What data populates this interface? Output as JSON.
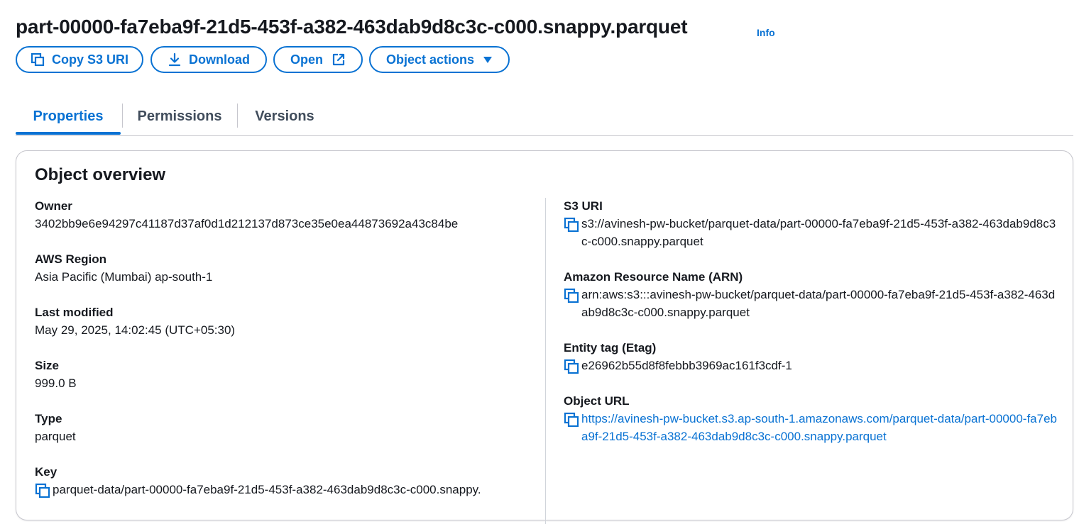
{
  "header": {
    "title": "part-00000-fa7eba9f-21d5-453f-a382-463dab9d8c3c-c000.snappy.parquet",
    "info_label": "Info"
  },
  "actions": {
    "copy_uri": "Copy S3 URI",
    "download": "Download",
    "open": "Open",
    "object_actions": "Object actions"
  },
  "tabs": [
    {
      "label": "Properties",
      "active": true
    },
    {
      "label": "Permissions",
      "active": false
    },
    {
      "label": "Versions",
      "active": false
    }
  ],
  "overview": {
    "title": "Object overview",
    "left": {
      "owner": {
        "label": "Owner",
        "value": "3402bb9e6e94297c41187d37af0d1d212137d873ce35e0ea44873692a43c84be"
      },
      "region": {
        "label": "AWS Region",
        "value": "Asia Pacific (Mumbai) ap-south-1"
      },
      "modified": {
        "label": "Last modified",
        "value": "May 29, 2025, 14:02:45 (UTC+05:30)"
      },
      "size": {
        "label": "Size",
        "value": "999.0 B"
      },
      "type": {
        "label": "Type",
        "value": "parquet"
      },
      "key": {
        "label": "Key",
        "value": "parquet-data/part-00000-fa7eba9f-21d5-453f-a382-463dab9d8c3c-c000.snappy."
      }
    },
    "right": {
      "s3uri": {
        "label": "S3 URI",
        "value": "s3://avinesh-pw-bucket/parquet-data/part-00000-fa7eba9f-21d5-453f-a382-463dab9d8c3c-c000.snappy.parquet"
      },
      "arn": {
        "label": "Amazon Resource Name (ARN)",
        "value": "arn:aws:s3:::avinesh-pw-bucket/parquet-data/part-00000-fa7eba9f-21d5-453f-a382-463dab9d8c3c-c000.snappy.parquet"
      },
      "etag": {
        "label": "Entity tag (Etag)",
        "value": "e26962b55d8f8febbb3969ac161f3cdf-1"
      },
      "url": {
        "label": "Object URL",
        "value": "https://avinesh-pw-bucket.s3.ap-south-1.amazonaws.com/parquet-data/part-00000-fa7eba9f-21d5-453f-a382-463dab9d8c3c-c000.snappy.parquet"
      }
    }
  },
  "colors": {
    "accent": "#0972d3",
    "text": "#16191f",
    "border": "#c6c6cd"
  },
  "icons": [
    "copy-icon",
    "download-icon",
    "external-link-icon",
    "caret-down-icon"
  ]
}
